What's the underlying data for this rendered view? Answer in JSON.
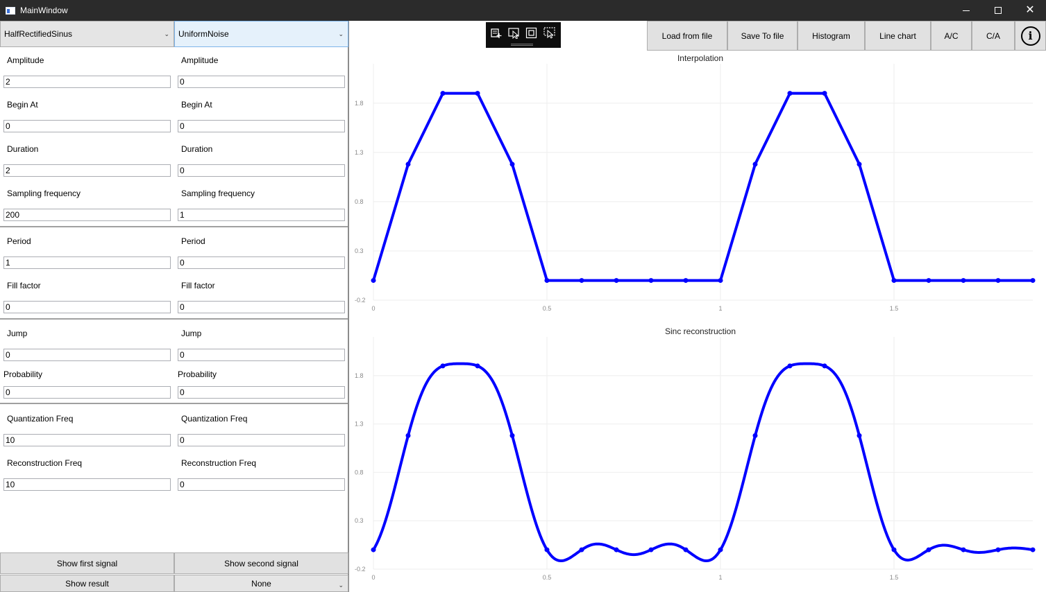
{
  "window": {
    "title": "MainWindow"
  },
  "left_panel": {
    "signal1": {
      "type": "HalfRectifiedSinus",
      "fields": {
        "amplitude": {
          "label": "Amplitude",
          "value": "2"
        },
        "begin_at": {
          "label": "Begin At",
          "value": "0"
        },
        "duration": {
          "label": "Duration",
          "value": "2"
        },
        "sampling_frequency": {
          "label": "Sampling frequency",
          "value": "200"
        },
        "period": {
          "label": "Period",
          "value": "1"
        },
        "fill_factor": {
          "label": "Fill factor",
          "value": "0"
        },
        "jump": {
          "label": "Jump",
          "value": "0"
        },
        "probability": {
          "label": "Probability",
          "value": "0"
        },
        "quantization_freq": {
          "label": "Quantization Freq",
          "value": "10"
        },
        "reconstruction_freq": {
          "label": "Reconstruction Freq",
          "value": "10"
        }
      }
    },
    "signal2": {
      "type": "UniformNoise",
      "fields": {
        "amplitude": {
          "label": "Amplitude",
          "value": "0"
        },
        "begin_at": {
          "label": "Begin At",
          "value": "0"
        },
        "duration": {
          "label": "Duration",
          "value": "0"
        },
        "sampling_frequency": {
          "label": "Sampling frequency",
          "value": "1"
        },
        "period": {
          "label": "Period",
          "value": "0"
        },
        "fill_factor": {
          "label": "Fill factor",
          "value": "0"
        },
        "jump": {
          "label": "Jump",
          "value": "0"
        },
        "probability": {
          "label": "Probability",
          "value": "0"
        },
        "quantization_freq": {
          "label": "Quantization Freq",
          "value": "0"
        },
        "reconstruction_freq": {
          "label": "Reconstruction Freq",
          "value": "0"
        }
      }
    },
    "buttons": {
      "show_first": "Show first signal",
      "show_second": "Show second signal",
      "show_result": "Show result",
      "operation": "None"
    }
  },
  "toolbar": {
    "buttons": [
      "Load from file",
      "Save To file",
      "Histogram",
      "Line chart",
      "A/C",
      "C/A"
    ],
    "info_icon": "info-icon",
    "floating_tools": [
      "add-data-icon",
      "select-icon",
      "zoom-fit-icon",
      "select-area-icon"
    ]
  },
  "colors": {
    "series": "#0000ff",
    "grid": "#eeeeee",
    "tick": "#888888",
    "titlebar": "#2b2b2b"
  },
  "chart_data": [
    {
      "type": "line",
      "title": "Interpolation",
      "xlim": [
        0,
        1.9
      ],
      "ylim": [
        -0.2,
        2.2
      ],
      "xticks": [
        "0",
        "0.5",
        "1",
        "1.5"
      ],
      "yticks": [
        "1.8",
        "1.3",
        "0.8",
        "0.3",
        "-0.2"
      ],
      "series": [
        {
          "x": [
            0,
            0.1,
            0.2,
            0.3,
            0.4,
            0.5,
            0.6,
            0.7,
            0.8,
            0.9,
            1.0,
            1.1,
            1.2,
            1.3,
            1.4,
            1.5,
            1.6,
            1.7,
            1.8,
            1.9
          ],
          "values": [
            0,
            1.18,
            1.9,
            1.9,
            1.18,
            0,
            0,
            0,
            0,
            0,
            0,
            1.18,
            1.9,
            1.9,
            1.18,
            0,
            0,
            0,
            0,
            0
          ]
        }
      ]
    },
    {
      "type": "line",
      "title": "Sinc reconstruction",
      "xlim": [
        0,
        1.9
      ],
      "ylim": [
        -0.2,
        2.2
      ],
      "xticks": [
        "0",
        "0.5",
        "1",
        "1.5"
      ],
      "yticks": [
        "1.8",
        "1.3",
        "0.8",
        "0.3",
        "-0.2"
      ],
      "series": [
        {
          "x": [
            0,
            0.1,
            0.2,
            0.3,
            0.4,
            0.5,
            0.6,
            0.7,
            0.8,
            0.9,
            1.0,
            1.1,
            1.2,
            1.3,
            1.4,
            1.5,
            1.6,
            1.7,
            1.8,
            1.9
          ],
          "values": [
            0,
            1.18,
            1.9,
            1.9,
            1.18,
            0,
            0,
            0,
            0,
            0,
            0,
            1.18,
            1.9,
            1.9,
            1.18,
            0,
            0,
            0,
            0,
            0
          ]
        }
      ]
    }
  ]
}
